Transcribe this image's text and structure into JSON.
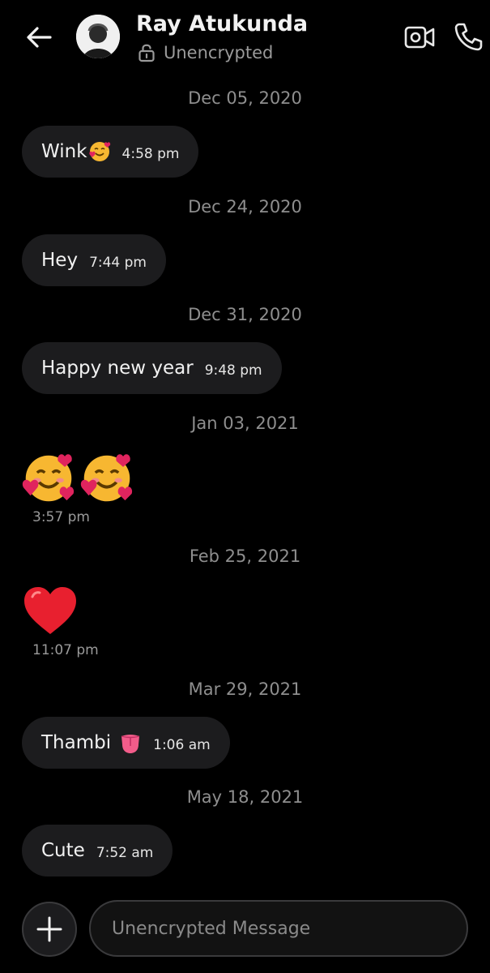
{
  "header": {
    "contact_name": "Ray Atukunda",
    "status": "Unencrypted"
  },
  "messages": [
    {
      "date": "Dec 05, 2020",
      "text": "Wink",
      "emoji": "smiling-face-with-hearts",
      "time": "4:58 pm"
    },
    {
      "date": "Dec 24, 2020",
      "text": "Hey",
      "time": "7:44 pm"
    },
    {
      "date": "Dec 31, 2020",
      "text": "Happy new year",
      "time": "9:48 pm"
    },
    {
      "date": "Jan 03, 2021",
      "emoji": "smiling-face-with-hearts x2",
      "time": "3:57 pm"
    },
    {
      "date": "Feb 25, 2021",
      "emoji": "red-heart",
      "time": "11:07 pm"
    },
    {
      "date": "Mar 29, 2021",
      "text": "Thambi",
      "emoji": "tongue",
      "time": "1:06 am"
    },
    {
      "date": "May 18, 2021",
      "text": "Cute",
      "time": "7:52 am"
    }
  ],
  "composer": {
    "placeholder": "Unencrypted Message"
  },
  "icons": {
    "back": "arrow-left-icon",
    "lock": "unlocked-padlock-icon",
    "video": "video-camera-icon",
    "call": "phone-icon",
    "add": "plus-icon"
  },
  "colors": {
    "background": "#000000",
    "bubble": "#1c1c1e",
    "muted_text": "#8e8e8e"
  }
}
